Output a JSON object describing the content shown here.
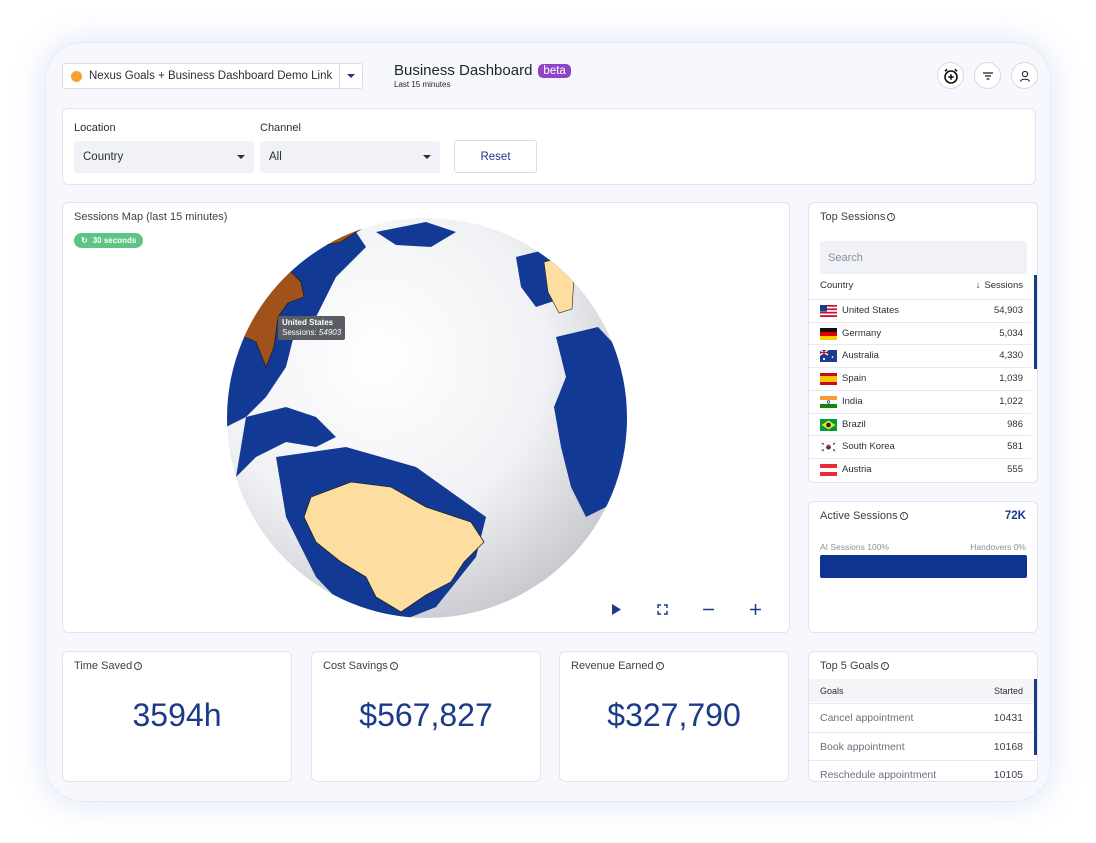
{
  "header": {
    "link_selector": "Nexus Goals + Business Dashboard Demo Link",
    "title": "Business Dashboard",
    "badge": "beta",
    "subtitle": "Last 15 minutes",
    "icons": [
      "alarm-add-icon",
      "filter-icon",
      "user-icon"
    ]
  },
  "filters": {
    "location_label": "Location",
    "location_value": "Country",
    "channel_label": "Channel",
    "channel_value": "All",
    "reset_label": "Reset"
  },
  "map": {
    "title": "Sessions Map (last 15 minutes)",
    "refresh_label": "30 seconds",
    "tooltip_country": "United States",
    "tooltip_label": "Sessions:",
    "tooltip_value": "54903",
    "controls": [
      "play-icon",
      "fullscreen-icon",
      "zoom-out-icon",
      "zoom-in-icon"
    ],
    "colors": {
      "ocean": "#ffffff",
      "land": "#123a94",
      "highlight": "#fddda0",
      "selected": "#a0521a"
    }
  },
  "top_sessions": {
    "title": "Top Sessions",
    "search_placeholder": "Search",
    "col_country": "Country",
    "col_sessions": "Sessions",
    "rows": [
      {
        "country": "United States",
        "sessions": "54,903",
        "flag": "us-flag-icon"
      },
      {
        "country": "Germany",
        "sessions": "5,034",
        "flag": "de-flag-icon"
      },
      {
        "country": "Australia",
        "sessions": "4,330",
        "flag": "au-flag-icon"
      },
      {
        "country": "Spain",
        "sessions": "1,039",
        "flag": "es-flag-icon"
      },
      {
        "country": "India",
        "sessions": "1,022",
        "flag": "in-flag-icon"
      },
      {
        "country": "Brazil",
        "sessions": "986",
        "flag": "br-flag-icon"
      },
      {
        "country": "South Korea",
        "sessions": "581",
        "flag": "kr-flag-icon"
      },
      {
        "country": "Austria",
        "sessions": "555",
        "flag": "at-flag-icon"
      }
    ]
  },
  "active_sessions": {
    "title": "Active Sessions",
    "value": "72K",
    "left_label": "AI Sessions 100%",
    "right_label": "Handovers 0%",
    "ai_fraction": 1.0
  },
  "kpis": [
    {
      "title": "Time Saved",
      "value": "3594h"
    },
    {
      "title": "Cost Savings",
      "value": "$567,827"
    },
    {
      "title": "Revenue Earned",
      "value": "$327,790"
    }
  ],
  "top_goals": {
    "title": "Top 5 Goals",
    "col_goal": "Goals",
    "col_started": "Started",
    "rows": [
      {
        "goal": "Cancel appointment",
        "started": "10431"
      },
      {
        "goal": "Book appointment",
        "started": "10168"
      },
      {
        "goal": "Reschedule appointment",
        "started": "10105"
      }
    ]
  }
}
